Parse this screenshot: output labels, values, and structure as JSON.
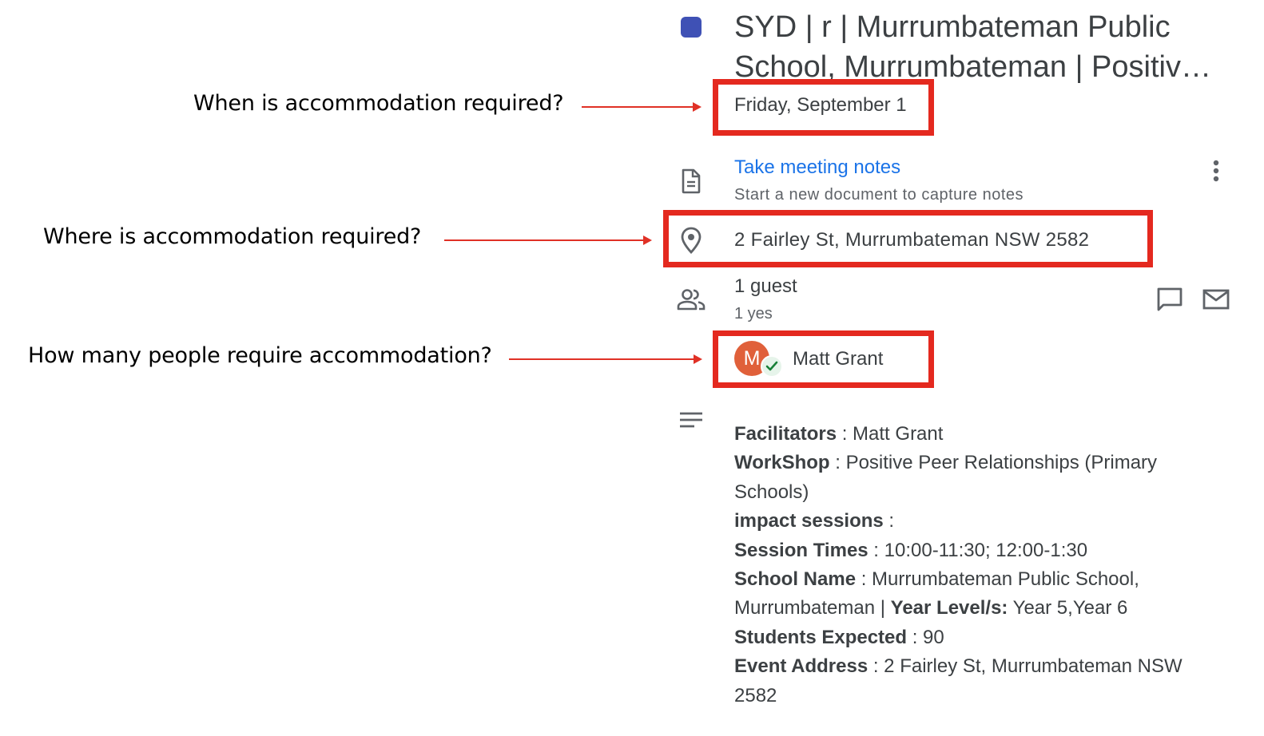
{
  "annotations": {
    "q_when": "When is accommodation required?",
    "q_where": "Where is accommodation required?",
    "q_how_many": "How many people require accommodation?",
    "arrow_color": "#e03126",
    "box_color": "#e4291f"
  },
  "event": {
    "calendar_color": "#3f51b5",
    "title_line1": "SYD | r | Murrumbateman Public",
    "title_line2": "School, Murrumbateman | Positiv…",
    "date": "Friday, September 1"
  },
  "notes": {
    "link": "Take meeting notes",
    "subtitle": "Start a new document to capture notes"
  },
  "location": {
    "address": "2 Fairley St, Murrumbateman NSW 2582"
  },
  "guests": {
    "count": "1 guest",
    "yes": "1 yes",
    "list": [
      {
        "initial": "M",
        "name": "Matt Grant",
        "avatar_color": "#e0603a"
      }
    ]
  },
  "description": {
    "facilitators_label": "Facilitators",
    "facilitators_value": " : Matt Grant",
    "workshop_label": "WorkShop",
    "workshop_value": " : Positive Peer Relationships (Primary Schools)",
    "impact_label": "impact sessions",
    "impact_value": " :",
    "session_label": "Session Times",
    "session_value": " : 10:00-11:30; 12:00-1:30",
    "school_label": "School Name",
    "school_value": " : Murrumbateman Public School, Murrumbateman | ",
    "year_label": "Year Level/s:",
    "year_value": " Year 5,Year 6",
    "students_label": "Students Expected",
    "students_value": " : 90",
    "address_label": "Event Address",
    "address_value": " : 2 Fairley St, Murrumbateman NSW 2582"
  },
  "icons": {
    "notes": "document-icon",
    "location": "location-pin-icon",
    "guests": "people-icon",
    "more": "more-vert-icon",
    "chat": "chat-icon",
    "email": "email-icon",
    "description": "notes-lines-icon"
  }
}
